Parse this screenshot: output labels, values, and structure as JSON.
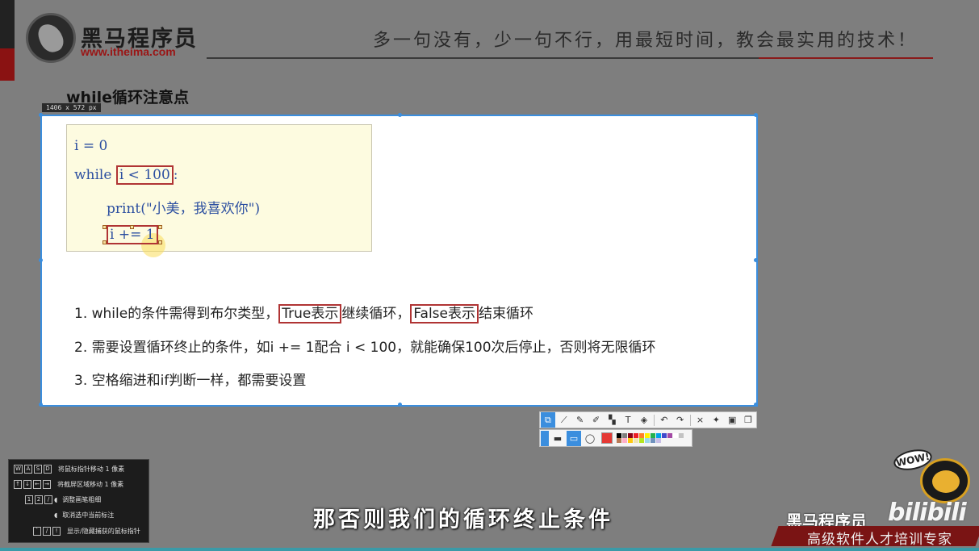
{
  "header": {
    "brand_name": "黑马程序员",
    "brand_url": "www.itheima.com",
    "slogan": "多一句没有，少一句不行，用最短时间，教会最实用的技术！"
  },
  "slide": {
    "title": "while循环注意点"
  },
  "capture": {
    "size_label": "1406 x 572  px"
  },
  "code": {
    "line1": "i = 0",
    "line2_kw": "while ",
    "line2_cond": "i < 100",
    "line2_colon": ":",
    "line3": "print(\"小美，我喜欢你\")",
    "line4": "i += 1"
  },
  "notes": {
    "n1_prefix": "1. while的条件需得到布尔类型，",
    "n1_box1": "True表示",
    "n1_mid": "继续循环，",
    "n1_box2": "False表示",
    "n1_suffix": "结束循环",
    "n2": "2. 需要设置循环终止的条件，如i += 1配合 i < 100，就能确保100次后停止，否则将无限循环",
    "n3": "3. 空格缩进和if判断一样，都需要设置"
  },
  "toolbar": {
    "tools": [
      "select-icon",
      "line-icon",
      "pen-icon",
      "highlighter-icon",
      "mosaic-icon",
      "text-icon",
      "eraser-icon",
      "undo-icon",
      "redo-icon",
      "close-icon",
      "pin-icon",
      "save-icon",
      "copy-icon"
    ],
    "text_tool": "T",
    "close_symbol": "×",
    "active_color": "#e53935",
    "palette": [
      "#000000",
      "#7f7f7f",
      "#880015",
      "#ed1c24",
      "#ff7f27",
      "#fff200",
      "#22b14c",
      "#00a2e8",
      "#3f48cc",
      "#a349a4",
      "#ffffff",
      "#c3c3c3",
      "#b97a57",
      "#ffaec9",
      "#ffc90e",
      "#efe4b0",
      "#b5e61d",
      "#99d9ea",
      "#7092be",
      "#c8bfe7"
    ]
  },
  "help": {
    "row1_keys": [
      "W",
      "A",
      "S",
      "D"
    ],
    "row1_text": "将鼠标指针移动 1 像素",
    "row2_keys": [
      "↑",
      "↓",
      "←",
      "→"
    ],
    "row2_text": "将截屏区域移动 1 像素",
    "row3_keys": [
      "1",
      "2",
      "/"
    ],
    "row3_text": "调整画笔粗细",
    "row4_text": "取消选中当前标注",
    "row5_keys": [
      "`",
      "/",
      "!"
    ],
    "row5_text": "显示/隐藏捕获的鼠标指针"
  },
  "subtitle": "那否则我们的循环终止条件",
  "footer": {
    "brand": "黑马程序员",
    "bilibili": "bilibili",
    "tagline": "高级软件人才培训专家",
    "wow": "WOW!"
  }
}
